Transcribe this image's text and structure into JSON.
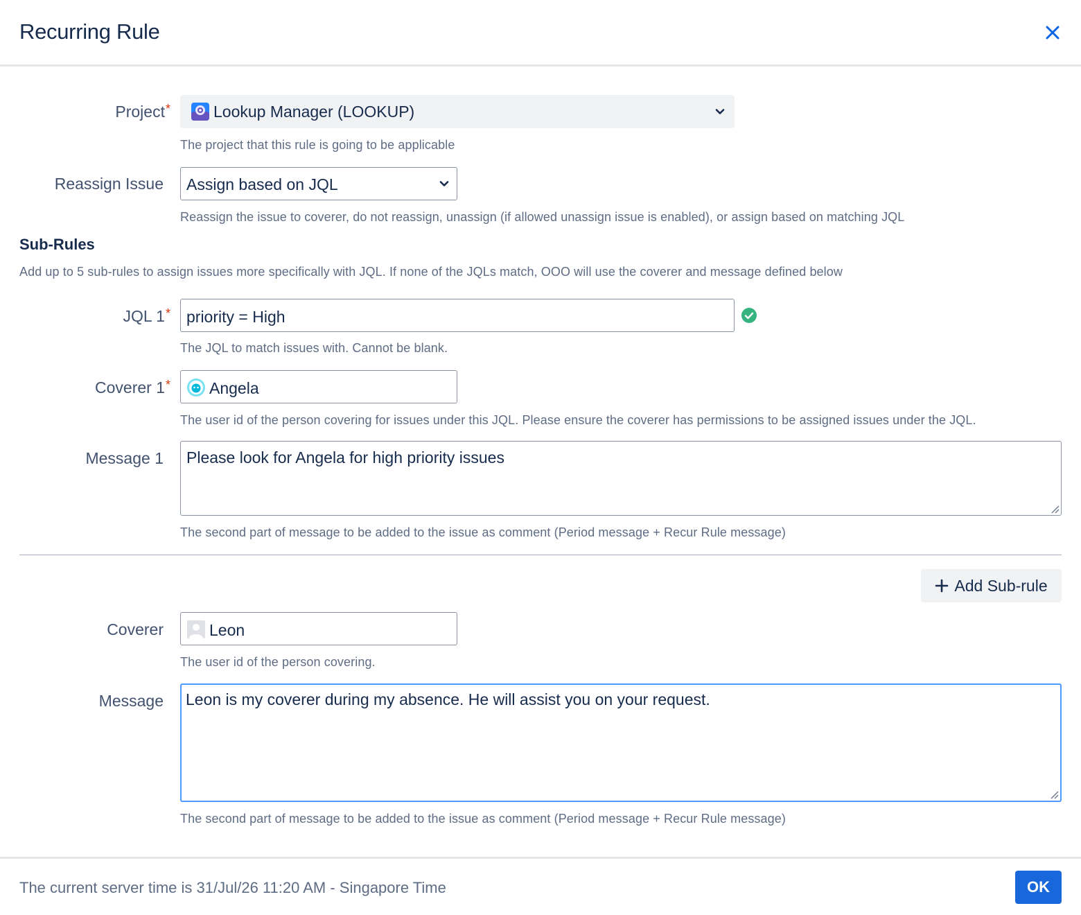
{
  "dialog": {
    "title": "Recurring Rule"
  },
  "project": {
    "label": "Project",
    "required_mark": "*",
    "value": "Lookup Manager (LOOKUP)",
    "help": "The project that this rule is going to be applicable"
  },
  "reassign": {
    "label": "Reassign Issue",
    "value": "Assign based on JQL",
    "help": "Reassign the issue to coverer, do not reassign, unassign (if allowed unassign issue is enabled), or assign based on matching JQL"
  },
  "subrules": {
    "title": "Sub-Rules",
    "description": "Add up to 5 sub-rules to assign issues more specifically with JQL. If none of the JQLs match, OOO will use the coverer and message defined below",
    "items": [
      {
        "jql_label": "JQL 1",
        "jql_value": "priority = High",
        "jql_help": "The JQL to match issues with. Cannot be blank.",
        "coverer_label": "Coverer 1",
        "coverer_value": "Angela",
        "coverer_help": "The user id of the person covering for issues under this JQL. Please ensure the coverer has permissions to be assigned issues under the JQL.",
        "message_label": "Message 1",
        "message_value": "Please look for Angela for high priority issues",
        "message_help": "The second part of message to be added to the issue as comment (Period message + Recur Rule message)"
      }
    ],
    "add_button": "Add Sub-rule"
  },
  "coverer": {
    "label": "Coverer",
    "value": "Leon",
    "help": "The user id of the person covering."
  },
  "message": {
    "label": "Message",
    "value": "Leon is my coverer during my absence. He will assist you on your request.",
    "help": "The second part of message to be added to the issue as comment (Period message + Recur Rule message)"
  },
  "footer": {
    "server_time": "The current server time is 31/Jul/26 11:20 AM - Singapore Time",
    "ok_label": "OK"
  },
  "icons": {
    "close": "close-icon",
    "project_avatar": "project-avatar-icon",
    "chevron": "chevron-down-icon",
    "valid": "check-circle-icon",
    "user_avatar": "user-avatar-icon",
    "add": "plus-icon"
  },
  "colors": {
    "primary": "#1868db",
    "valid": "#36b37e",
    "required": "#de350b",
    "focus_border": "#4c9aff"
  }
}
